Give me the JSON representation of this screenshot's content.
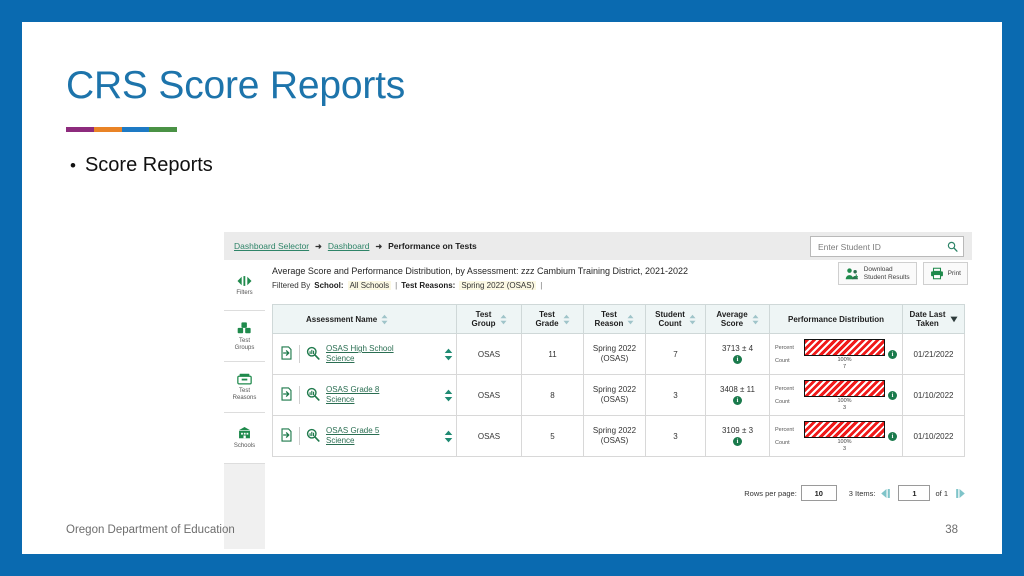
{
  "slide": {
    "title": "CRS Score Reports",
    "bullet": "Score Reports",
    "footer_left": "Oregon Department of Education",
    "page_number": "38",
    "accent_colors": [
      "#8d2b7d",
      "#e98326",
      "#1e7ac4",
      "#4a9245"
    ],
    "frame_color": "#0a6ab0",
    "title_color": "#1d74ab"
  },
  "app": {
    "breadcrumb": {
      "items": [
        "Dashboard Selector",
        "Dashboard"
      ],
      "current": "Performance on Tests",
      "separator": "➜"
    },
    "search": {
      "placeholder": "Enter Student ID",
      "value": "",
      "icon": "search-icon"
    },
    "report": {
      "title": "Average Score and Performance Distribution, by Assessment: zzz Cambium Training District, 2021-2022",
      "filtered_by_label": "Filtered By",
      "filters": [
        {
          "label": "School:",
          "value": "All Schools"
        },
        {
          "label": "Test Reasons:",
          "value": "Spring 2022 (OSAS)"
        }
      ],
      "pipe": "|"
    },
    "actions": [
      {
        "name": "download-student-results-button",
        "line1": "Download",
        "line2": "Student Results",
        "icon": "people-download-icon"
      },
      {
        "name": "print-button",
        "line1": "Print",
        "line2": "",
        "icon": "printer-icon"
      }
    ],
    "rail": [
      {
        "label": "Filters",
        "icon": "filters-icon"
      },
      {
        "label": "Test\nGroups",
        "label1": "Test",
        "label2": "Groups",
        "icon": "test-groups-icon"
      },
      {
        "label": "Test Reasons",
        "label1": "Test",
        "label2": "Reasons",
        "icon": "test-reasons-icon"
      },
      {
        "label": "Schools",
        "label1": "Schools",
        "label2": "",
        "icon": "schools-icon"
      }
    ],
    "table": {
      "columns": [
        {
          "key": "assessment_name",
          "label": "Assessment Name",
          "sortable": true,
          "sorted": false
        },
        {
          "key": "test_group",
          "label1": "Test",
          "label2": "Group",
          "sortable": true,
          "sorted": false
        },
        {
          "key": "test_grade",
          "label1": "Test",
          "label2": "Grade",
          "sortable": true,
          "sorted": false
        },
        {
          "key": "test_reason",
          "label1": "Test",
          "label2": "Reason",
          "sortable": true,
          "sorted": false
        },
        {
          "key": "student_count",
          "label1": "Student",
          "label2": "Count",
          "sortable": true,
          "sorted": false
        },
        {
          "key": "average_score",
          "label1": "Average",
          "label2": "Score",
          "sortable": true,
          "sorted": false
        },
        {
          "key": "performance_distribution",
          "label": "Performance Distribution",
          "sortable": false,
          "sorted": false
        },
        {
          "key": "date_last_taken",
          "label1": "Date Last",
          "label2": "Taken",
          "sortable": true,
          "sorted": true
        }
      ],
      "rows": [
        {
          "assessment_name_line1": "OSAS High School",
          "assessment_name_line2": "Science",
          "test_group": "OSAS",
          "test_grade": "11",
          "test_reason_line1": "Spring 2022",
          "test_reason_line2": "(OSAS)",
          "student_count": "7",
          "average_score": "3713 ± 4",
          "perf_percent_label": "Percent",
          "perf_count_label": "Count",
          "perf_percent": "100%",
          "perf_count": "7",
          "date_last_taken": "01/21/2022"
        },
        {
          "assessment_name_line1": "OSAS Grade 8",
          "assessment_name_line2": "Science",
          "test_group": "OSAS",
          "test_grade": "8",
          "test_reason_line1": "Spring 2022",
          "test_reason_line2": "(OSAS)",
          "student_count": "3",
          "average_score": "3408 ± 11",
          "perf_percent_label": "Percent",
          "perf_count_label": "Count",
          "perf_percent": "100%",
          "perf_count": "3",
          "date_last_taken": "01/10/2022"
        },
        {
          "assessment_name_line1": "OSAS Grade 5",
          "assessment_name_line2": "Science",
          "test_group": "OSAS",
          "test_grade": "5",
          "test_reason_line1": "Spring 2022",
          "test_reason_line2": "(OSAS)",
          "student_count": "3",
          "average_score": "3109 ± 3",
          "perf_percent_label": "Percent",
          "perf_count_label": "Count",
          "perf_percent": "100%",
          "perf_count": "3",
          "date_last_taken": "01/10/2022"
        }
      ]
    },
    "pagination": {
      "rows_per_page_label": "Rows per page:",
      "rows_per_page_value": "10",
      "items_label": "3 Items:",
      "page_value": "1",
      "of_label": "of 1",
      "prev_icon": "previous-page-icon",
      "next_icon": "next-page-icon"
    },
    "colors": {
      "link_green": "#2e8468",
      "info_green": "#1a7a4c",
      "bar_red": "#f01a1a",
      "header_bg": "#eef5f5"
    }
  }
}
